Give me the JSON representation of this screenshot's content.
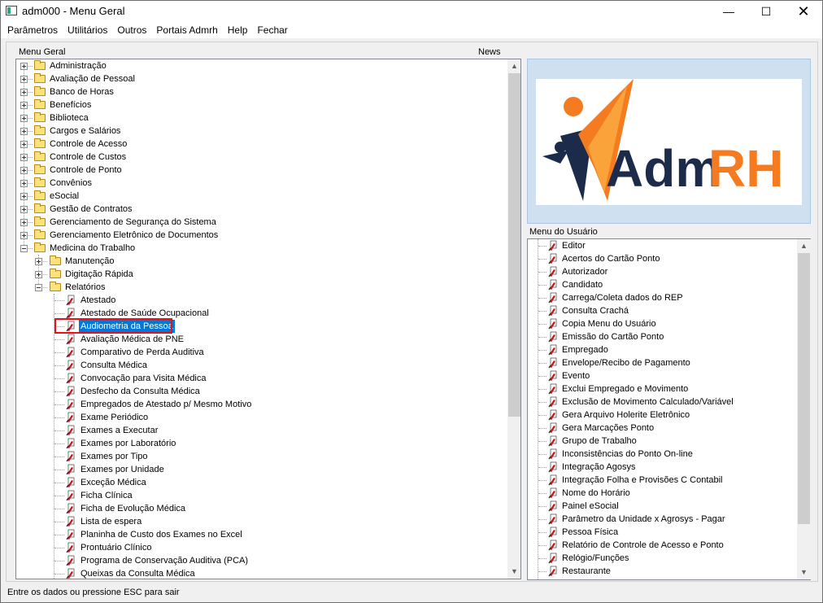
{
  "window": {
    "title": "adm000 - Menu Geral"
  },
  "menubar": [
    "Parâmetros",
    "Utilitários",
    "Outros",
    "Portais Admrh",
    "Help",
    "Fechar"
  ],
  "labels": {
    "menu_geral": "Menu Geral",
    "news": "News",
    "menu_usuario": "Menu do Usuário"
  },
  "logo": {
    "text_adm": "Adm",
    "text_rh": "RH",
    "colors": {
      "navy": "#1c2b49",
      "orange": "#f47b20"
    }
  },
  "tree": {
    "top_folders": [
      "Administração",
      "Avaliação de Pessoal",
      "Banco de Horas",
      "Benefícios",
      "Biblioteca",
      "Cargos e Salários",
      "Controle de Acesso",
      "Controle de Custos",
      "Controle de Ponto",
      "Convênios",
      "eSocial",
      "Gestão de Contratos",
      "Gerenciamento de Segurança do Sistema",
      "Gerenciamento Eletrônico de Documentos",
      "Medicina do Trabalho"
    ],
    "medicina_children": [
      "Manutenção",
      "Digitação Rápida",
      "Relatórios"
    ],
    "relatorios": [
      "Atestado",
      "Atestado de Saúde Ocupacional",
      "Audiometria da Pessoa",
      "Avaliação Médica de PNE",
      "Comparativo de Perda Auditiva",
      "Consulta Médica",
      "Convocação para Visita Médica",
      "Desfecho da Consulta Médica",
      "Empregados de Atestado p/ Mesmo Motivo",
      "Exame Periódico",
      "Exames a Executar",
      "Exames por Laboratório",
      "Exames por Tipo",
      "Exames por Unidade",
      "Exceção Médica",
      "Ficha Clínica",
      "Ficha de Evolução Médica",
      "Lista de espera",
      "Planinha de Custo dos Exames no Excel",
      "Prontuário Clínico",
      "Programa de Conservação Auditiva (PCA)",
      "Queixas da Consulta Médica"
    ],
    "selected": "Audiometria da Pessoa"
  },
  "user_menu": [
    "Editor",
    "Acertos do Cartão Ponto",
    "Autorizador",
    "Candidato",
    "Carrega/Coleta dados do REP",
    "Consulta Crachá",
    "Copia Menu do Usuário",
    "Emissão do Cartão Ponto",
    "Empregado",
    "Envelope/Recibo de Pagamento",
    "Evento",
    "Exclui Empregado e Movimento",
    "Exclusão de Movimento Calculado/Variável",
    "Gera Arquivo Holerite Eletrônico",
    "Gera Marcações Ponto",
    "Grupo de Trabalho",
    "Inconsistências do Ponto On-line",
    "Integração Agosys",
    "Integração Folha e Provisões C Contabil",
    "Nome do Horário",
    "Painel eSocial",
    "Parâmetro da Unidade x Agrosys - Pagar",
    "Pessoa Física",
    "Relatório de Controle de Acesso e Ponto",
    "Relógio/Funções",
    "Restaurante"
  ],
  "status": "Entre os dados ou pressione ESC para sair"
}
